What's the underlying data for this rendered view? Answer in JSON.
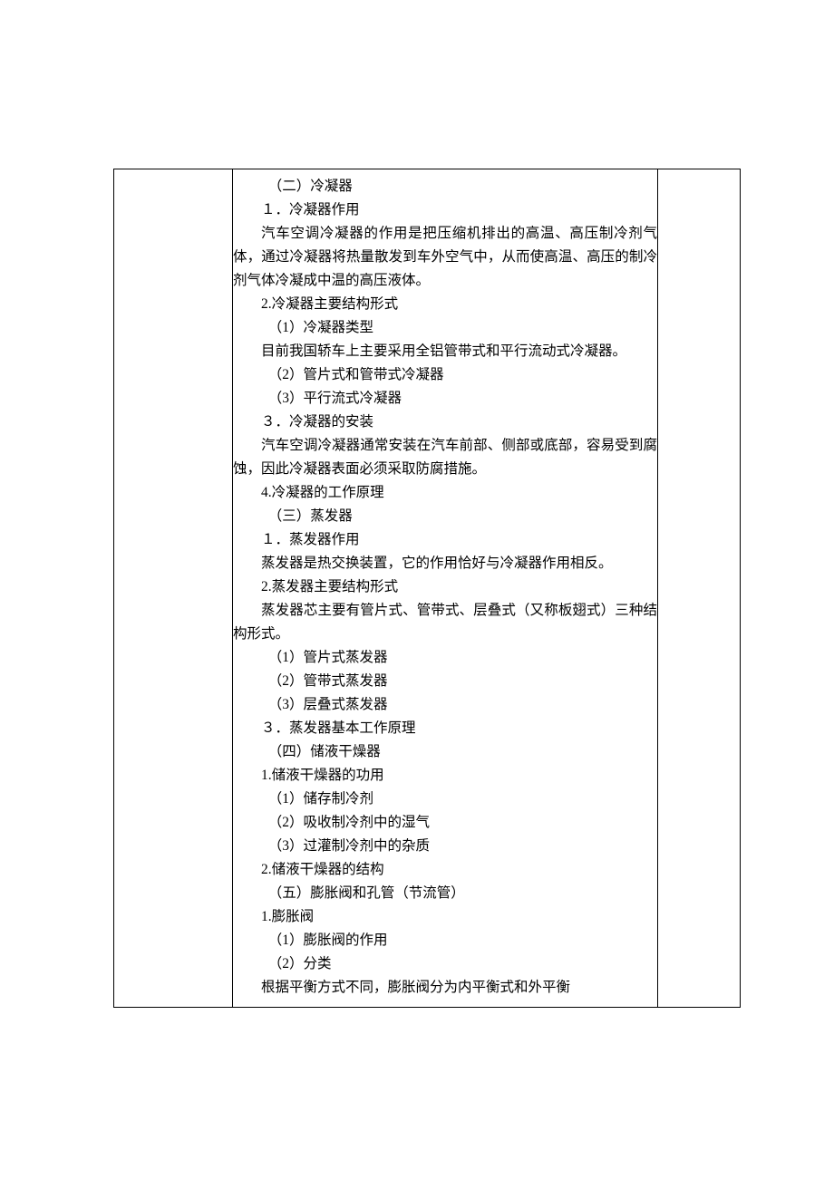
{
  "content": {
    "p01": "（二）冷凝器",
    "p02": "１．冷凝器作用",
    "p03": "汽车空调冷凝器的作用是把压缩机排出的高温、高压制冷剂气体，通过冷凝器将热量散发到车外空气中，从而使高温、高压的制冷剂气体冷凝成中温的高压液体。",
    "p04": "2.冷凝器主要结构形式",
    "p05": "（1）冷凝器类型",
    "p06": "目前我国轿车上主要采用全铝管带式和平行流动式冷凝器。",
    "p07": "（2）管片式和管带式冷凝器",
    "p08": "（3）平行流式冷凝器",
    "p09": "３．冷凝器的安装",
    "p10": "汽车空调冷凝器通常安装在汽车前部、侧部或底部，容易受到腐蚀，因此冷凝器表面必须采取防腐措施。",
    "p11": "4.冷凝器的工作原理",
    "p12": "（三）蒸发器",
    "p13": "１．蒸发器作用",
    "p14": "蒸发器是热交换装置，它的作用恰好与冷凝器作用相反。",
    "p15": "2.蒸发器主要结构形式",
    "p16": "蒸发器芯主要有管片式、管带式、层叠式（又称板翅式）三种结构形式。",
    "p17": "（1）管片式蒸发器",
    "p18": "（2）管带式蒸发器",
    "p19": "（3）层叠式蒸发器",
    "p20": "３．蒸发器基本工作原理",
    "p21": "（四）储液干燥器",
    "p22": "1.储液干燥器的功用",
    "p23": "（1）储存制冷剂",
    "p24": "（2）吸收制冷剂中的湿气",
    "p25": "（3）过灌制冷剂中的杂质",
    "p26": "2.储液干燥器的结构",
    "p27": "（五）膨胀阀和孔管（节流管）",
    "p28": "1.膨胀阀",
    "p29": "（1）膨胀阀的作用",
    "p30": "（2）分类",
    "p31": "根据平衡方式不同，膨胀阀分为内平衡式和外平衡"
  }
}
